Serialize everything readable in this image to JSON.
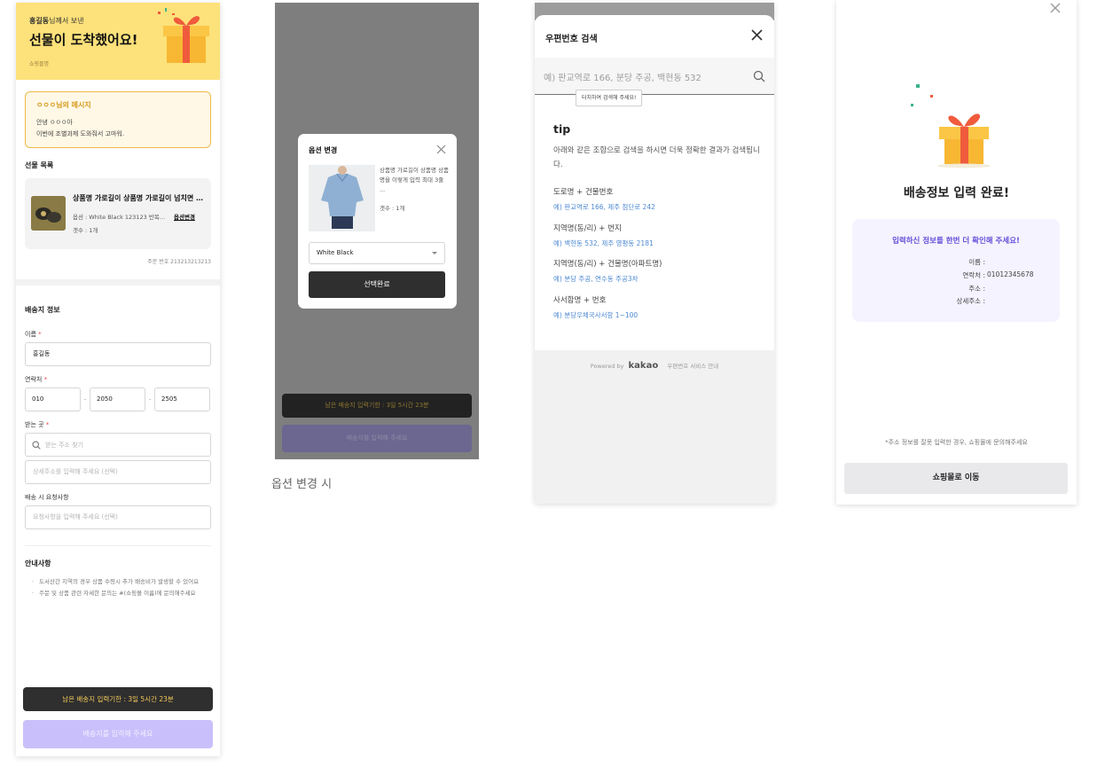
{
  "screen1": {
    "hero": {
      "sender": "홍길동",
      "sender_suffix": "님께서 보낸",
      "title": "선물이 도착했어요!",
      "brand": "쇼핑몰명"
    },
    "message": {
      "title": "ㅇㅇㅇ님의 메시지",
      "line1": "안녕 ㅇㅇㅇ아",
      "line2": "이번에 조별과제 도와줘서 고마워."
    },
    "gift_list_label": "선물 목록",
    "product": {
      "name": "상품명 가로길이 상품명 가로길이 넘치면 말줄임",
      "option": "옵션 : White Black 123123 반복반복",
      "option_button": "옵션변경",
      "quantity": "갯수 : 1개"
    },
    "order_number": "주문 번호 213213213213",
    "shipping": {
      "title": "배송지 정보",
      "name_label": "이름",
      "name_value": "홍길동",
      "phone_label": "연락처",
      "phone": [
        "010",
        "2050",
        "2505"
      ],
      "address_label": "받는 곳",
      "address_search_placeholder": "받는 주소 찾기",
      "address_detail_placeholder": "상세주소를 입력해 주세요 (선택)",
      "request_label": "배송 시 요청사항",
      "request_placeholder": "요청사항을 입력해 주세요 (선택)",
      "required_mark": "*"
    },
    "notice": {
      "title": "안내사항",
      "items": [
        "도서산간 지역의 경우 상품 수령시 추가 배송비가 발생할 수 있어요",
        "주문 및 상품 관련 자세한 문의는 #(쇼핑몰 이름)에 문의해주세요"
      ]
    },
    "deadline": "남은 배송지 입력기한 : 3일 5시간 23분",
    "submit": "배송지를 입력해 주세요"
  },
  "screen2": {
    "modal": {
      "title": "옵션 변경",
      "description": "상품명 가로길이 상품명 상품명을 이렇게 입력 최대 3줄 ...",
      "quantity": "갯수 : 1개",
      "selected_option": "White Black",
      "confirm": "선택완료"
    },
    "deadline": "남은 배송지 입력기한 : 3일 5시간 23분",
    "submit": "배송지를 입력해 주세요",
    "caption": "옵션 변경 시"
  },
  "screen3": {
    "title": "우편번호 검색",
    "search_placeholder": "예) 판교역로 166, 분당 주공, 백현동 532",
    "tooltip": "터치하여 검색해 주세요!",
    "tip_title": "tip",
    "tip_desc": "아래와 같은 조합으로 검색을 하시면 더욱 정확한 결과가 검색됩니다.",
    "tips": [
      {
        "heading": "도로명 + 건물번호",
        "example": "예) 판교역로 166,  제주 첨단로 242"
      },
      {
        "heading": "지역명(동/리) + 번지",
        "example": "예) 백현동 532,  제주 영평동 2181"
      },
      {
        "heading": "지역명(동/리) + 건물명(아파트명)",
        "example": "예) 분당 주공,  연수동 주공3차"
      },
      {
        "heading": "사서함명 + 번호",
        "example": "예) 분당우체국사서함 1~100"
      }
    ],
    "footer": {
      "powered_by": "Powered by",
      "brand": "kakao",
      "service_info": "우편번호 서비스 안내"
    }
  },
  "screen4": {
    "title": "배송정보 입력 완료!",
    "box_title": "입력하신 정보를 한번 더 확인해 주세요!",
    "rows": [
      {
        "label": "이름 :",
        "value": ""
      },
      {
        "label": "연락처 :",
        "value": "01012345678"
      },
      {
        "label": "주소 :",
        "value": ""
      },
      {
        "label": "상세주소 :",
        "value": ""
      }
    ],
    "note": "*주소 정보를 잘못 입력한 경우, 쇼핑몰에 문의해주세요",
    "button": "쇼핑몰로 이동"
  },
  "colors": {
    "hero_yellow": "#fde17a",
    "message_border": "#f0b84a",
    "deadline_text": "#f3c95a",
    "submit_disabled": "#c9c0fb",
    "tip_link": "#4e8ad2",
    "confirm_purple": "#6450d8"
  },
  "icons": [
    "gift-box-icon",
    "close-icon",
    "search-icon",
    "dropdown-caret-icon"
  ]
}
